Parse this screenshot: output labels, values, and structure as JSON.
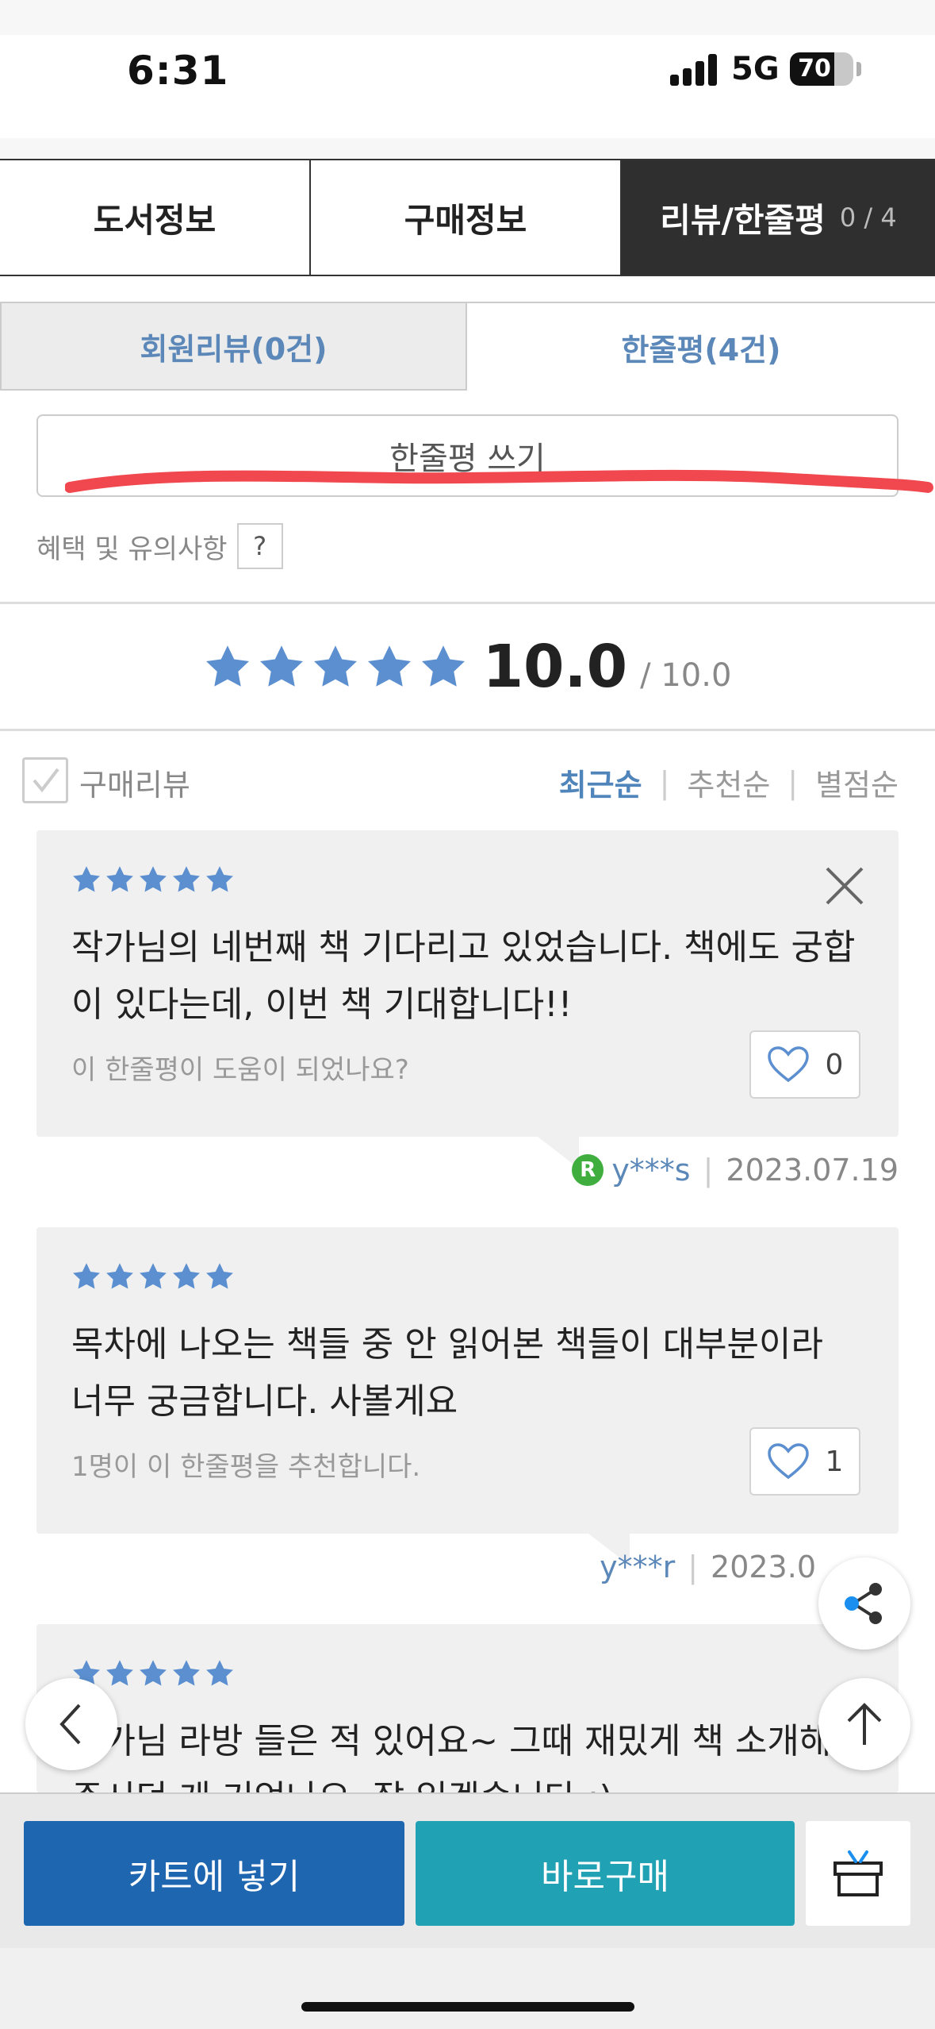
{
  "status_bar": {
    "time": "6:31",
    "network": "5G",
    "battery": "70",
    "battery_level": 0.7
  },
  "main_tabs": [
    {
      "label": "도서정보"
    },
    {
      "label": "구매정보"
    },
    {
      "label": "리뷰/한줄평",
      "count": "0 / 4"
    }
  ],
  "sub_tabs": [
    {
      "label": "회원리뷰(0건)"
    },
    {
      "label": "한줄평(4건)"
    }
  ],
  "write_button": "한줄평 쓰기",
  "notice": {
    "label": "혜택 및 유의사항",
    "help": "?"
  },
  "rating": {
    "score": "10.0",
    "max": "/ 10.0"
  },
  "filter": {
    "checkbox_label": "구매리뷰",
    "sort": [
      "최근순",
      "추천순",
      "별점순"
    ]
  },
  "reviews": [
    {
      "text": "작가님의 네번째 책 기다리고 있었습니다. 책에도 궁합이 있다는데, 이번 책 기대합니다!!",
      "helpful": "이 한줄평이 도움이 되었나요?",
      "likes": "0",
      "badge": "R",
      "author": "y***s",
      "date": "2023.07.19"
    },
    {
      "text": "목차에 나오는 책들 중 안 읽어본 책들이 대부분이라 너무 궁금합니다. 사볼게요",
      "helpful": "1명이 이 한줄평을 추천합니다.",
      "likes": "1",
      "author": "y***r",
      "date": "2023.0"
    },
    {
      "text": "작가님 라방 들은 적 있어요~ 그때 재밌게 책 소개해 주시던 게 기억나요. 잘 읽겠습니다 :)"
    }
  ],
  "bottom_bar": {
    "cart_label": "카트에 넣기",
    "buy_label": "바로구매"
  },
  "colors": {
    "accent_blue": "#5b88b8",
    "star_blue": "#5b8fcf",
    "cart_blue": "#1f66b1",
    "buy_teal": "#21a1b4",
    "active_tab": "#2f2f2f",
    "red_mark": "#f0484e"
  },
  "icons": [
    "star-icon",
    "close-icon",
    "heart-icon",
    "share-icon",
    "arrow-up-icon",
    "chevron-left-icon",
    "gift-icon",
    "check-icon",
    "r-badge-icon"
  ]
}
